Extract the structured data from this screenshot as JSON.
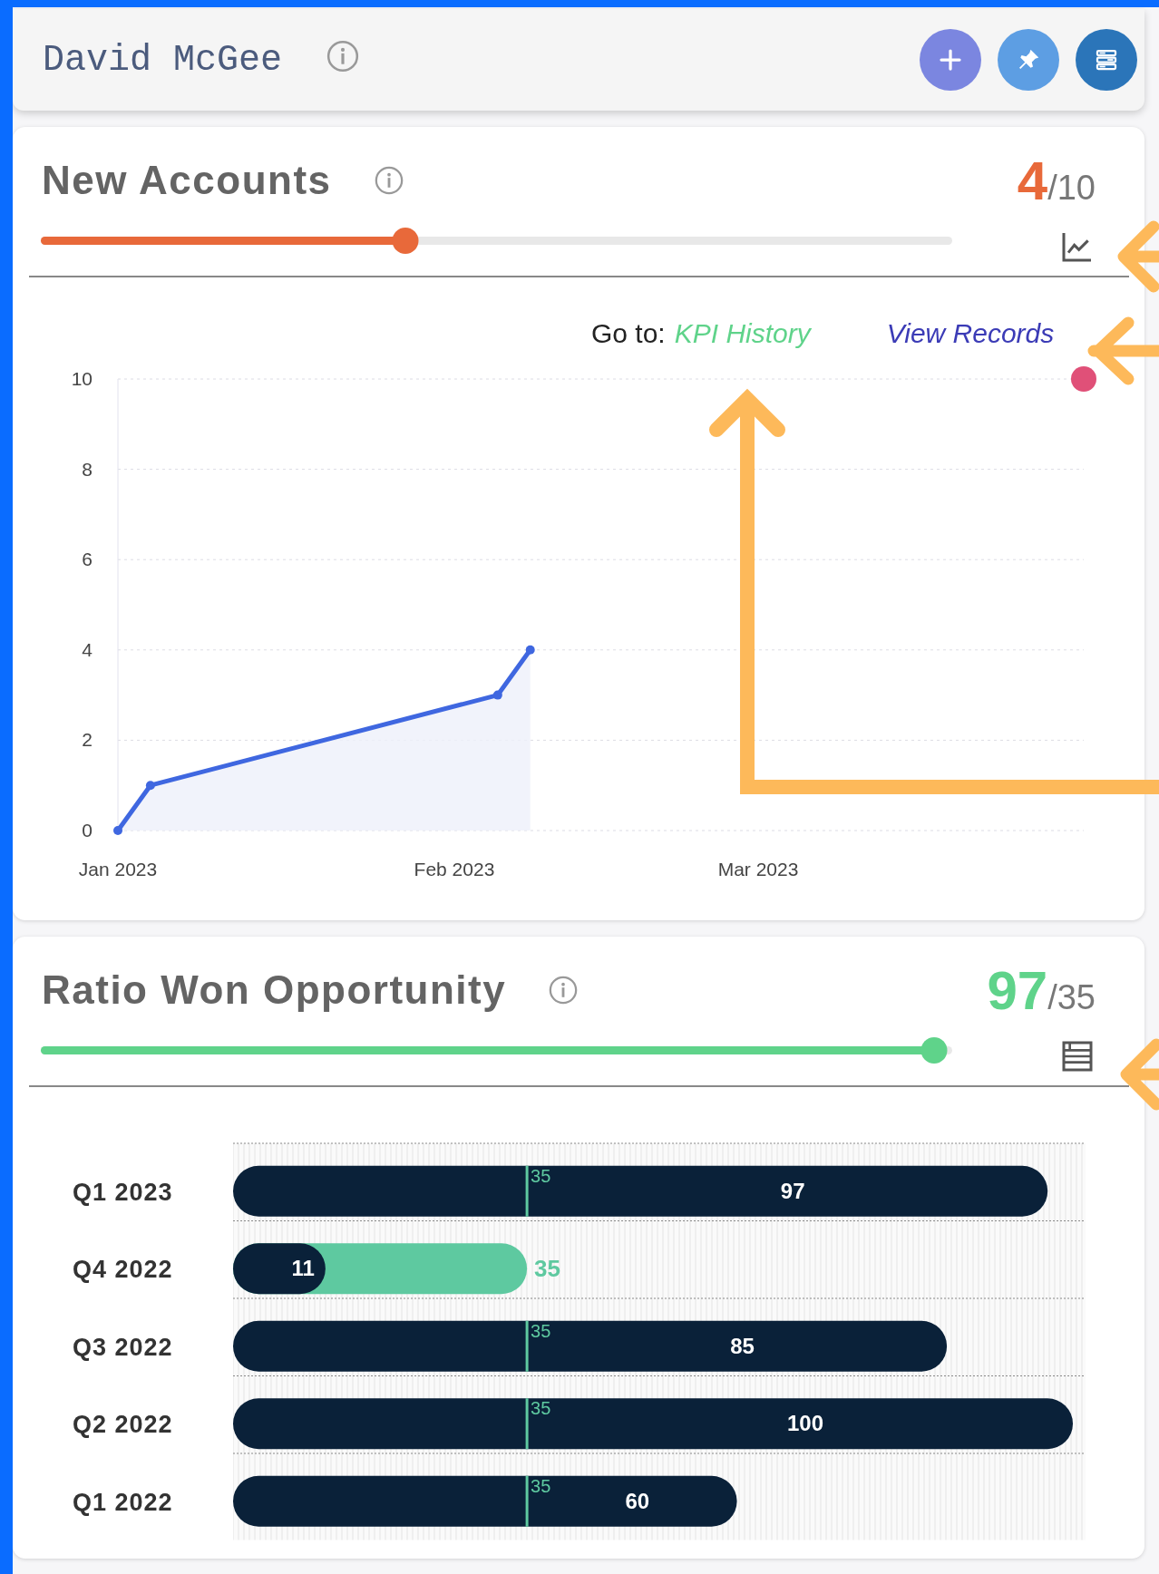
{
  "header": {
    "title": "David McGee",
    "buttons": [
      {
        "kind": "add"
      },
      {
        "kind": "pin"
      },
      {
        "kind": "layout"
      }
    ]
  },
  "kpis": [
    {
      "title": "New Accounts",
      "value": "4",
      "target": "/10",
      "color": "#e8693a",
      "level": 0.4,
      "links": {
        "prefix": "Go to:",
        "history": "KPI History",
        "records": "View Records"
      },
      "chart_data": {
        "type": "area",
        "x": [
          "2023-01-01",
          "2023-01-04",
          "2023-02-05",
          "2023-02-08"
        ],
        "series": [
          {
            "color": "#3f67e0",
            "values": [
              0,
              1,
              3,
              4
            ]
          }
        ],
        "xlim": [
          "2023-01-01",
          "2023-03-31"
        ],
        "ylim": [
          0,
          10
        ],
        "grid": true,
        "yticks": [
          0,
          2,
          4,
          6,
          8,
          10
        ],
        "xticks": [
          {
            "value": "2023-01-01",
            "label": "Jan 2023"
          },
          {
            "value": "2023-02-01",
            "label": "Feb 2023"
          },
          {
            "value": "2023-03-01",
            "label": "Mar 2023"
          }
        ]
      }
    },
    {
      "title": "Ratio Won Opportunity",
      "value": "97",
      "target": "/35",
      "color": "#5fd38a",
      "level": 0.98,
      "chart_data": {
        "type": "bar",
        "orientation": "horizontal",
        "categories": [
          "Q1 2023",
          "Q4 2022",
          "Q3 2022",
          "Q2 2022",
          "Q1 2022"
        ],
        "series": [
          {
            "color": "#0a2139",
            "values": [
              97,
              11,
              85,
              100,
              60
            ]
          },
          {
            "color": "#5ec9a0",
            "values": [
              null,
              35,
              null,
              null,
              null
            ]
          }
        ],
        "ref_lines": [
          {
            "label": "35",
            "color": "#5ec9a0"
          }
        ],
        "xlim": [
          0,
          100
        ],
        "data_labels": true
      }
    }
  ]
}
